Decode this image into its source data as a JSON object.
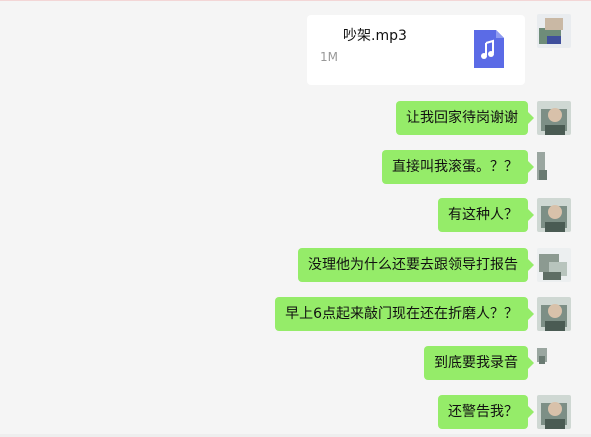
{
  "file_message": {
    "name": "吵架.mp3",
    "size": "1M",
    "icon": "music-file-icon",
    "icon_color": "#5b6be6"
  },
  "messages": [
    {
      "text": "让我回家待岗谢谢"
    },
    {
      "text": "直接叫我滚蛋。？？"
    },
    {
      "text": "有这种人？"
    },
    {
      "text": "没理他为什么还要去跟领导打报告"
    },
    {
      "text": "早上6点起来敲门现在还在折磨人？？"
    },
    {
      "text": "到底要我录音"
    },
    {
      "text": "还警告我？"
    }
  ],
  "colors": {
    "bubble": "#95ec69",
    "background": "#f5f5f5"
  }
}
